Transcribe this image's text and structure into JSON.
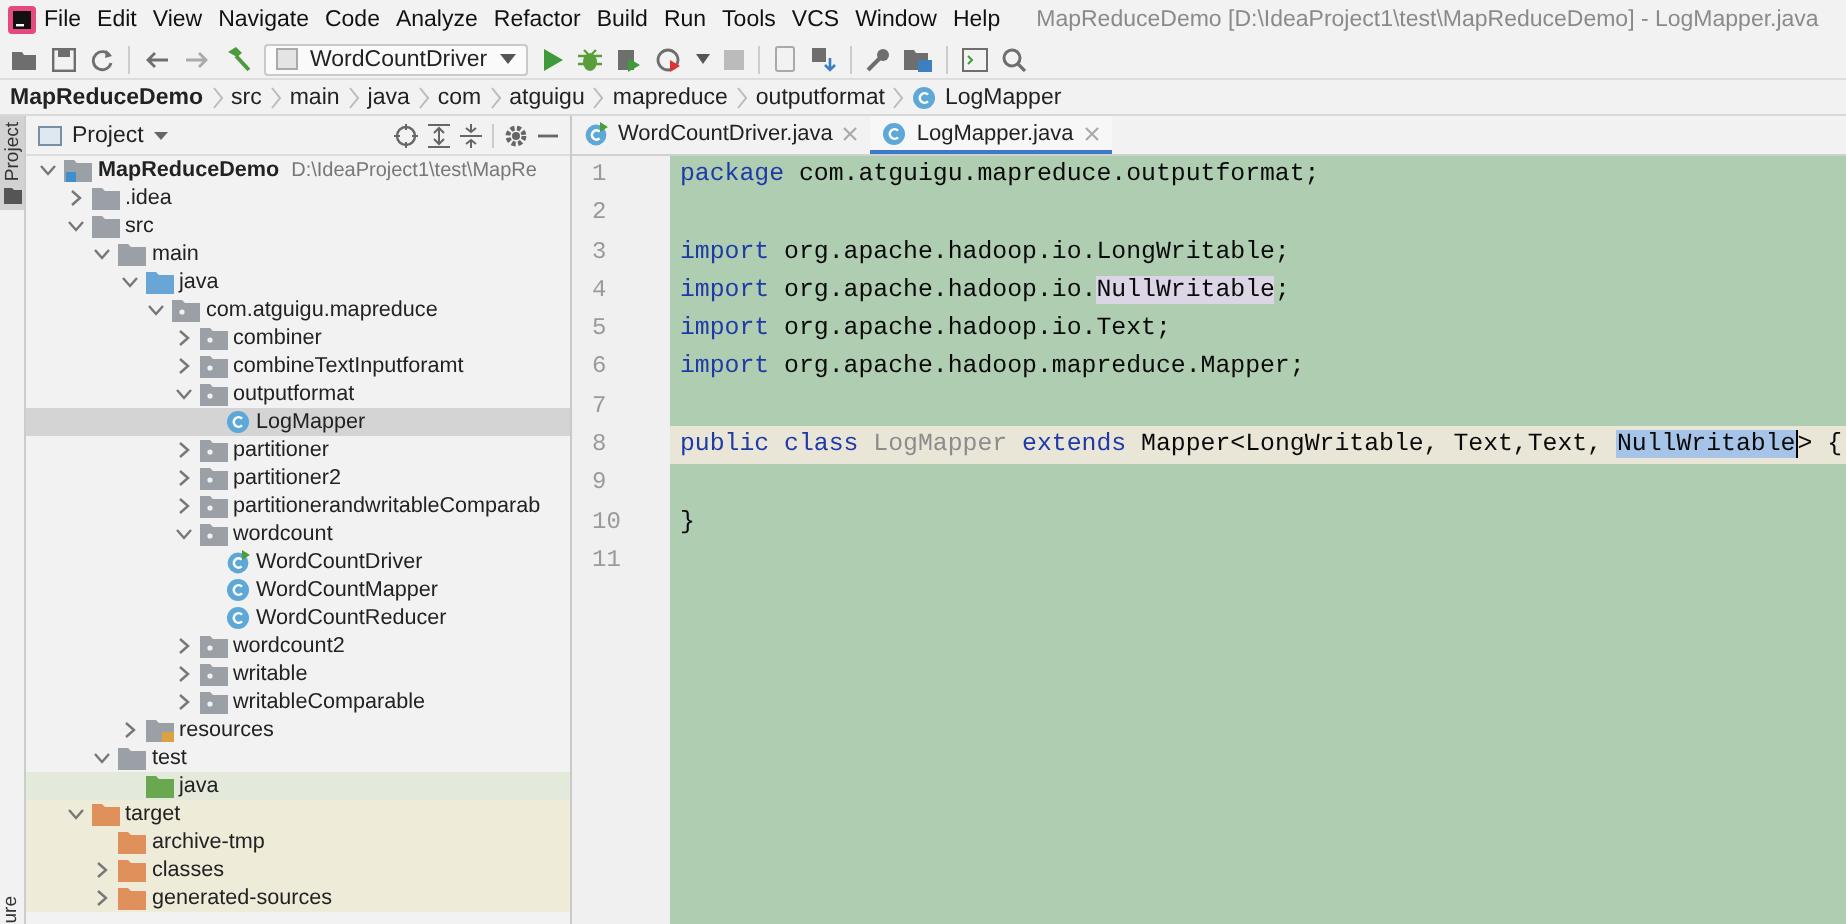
{
  "window": {
    "title": "MapReduceDemo [D:\\IdeaProject1\\test\\MapReduceDemo] - LogMapper.java"
  },
  "menu": [
    "File",
    "Edit",
    "View",
    "Navigate",
    "Code",
    "Analyze",
    "Refactor",
    "Build",
    "Run",
    "Tools",
    "VCS",
    "Window",
    "Help"
  ],
  "toolbar": {
    "run_config": "WordCountDriver"
  },
  "breadcrumbs": [
    {
      "label": "MapReduceDemo",
      "kind": "project"
    },
    {
      "label": "src",
      "kind": "dir"
    },
    {
      "label": "main",
      "kind": "dir"
    },
    {
      "label": "java",
      "kind": "dir"
    },
    {
      "label": "com",
      "kind": "dir"
    },
    {
      "label": "atguigu",
      "kind": "dir"
    },
    {
      "label": "mapreduce",
      "kind": "dir"
    },
    {
      "label": "outputformat",
      "kind": "dir"
    },
    {
      "label": "LogMapper",
      "kind": "class"
    }
  ],
  "side_strip": {
    "tabs": [
      {
        "label": "Project",
        "selected": true
      }
    ],
    "bottom_label": "ure"
  },
  "project_panel": {
    "title": "Project",
    "tree": [
      {
        "label": "MapReduceDemo",
        "path": "D:\\IdeaProject1\\test\\MapRe",
        "kind": "module",
        "expanded": true,
        "selected": false,
        "children": [
          {
            "label": ".idea",
            "kind": "folder",
            "expanded": false,
            "selected": false
          },
          {
            "label": "src",
            "kind": "folder",
            "expanded": true,
            "selected": false,
            "children": [
              {
                "label": "main",
                "kind": "folder",
                "expanded": true,
                "selected": false,
                "children": [
                  {
                    "label": "java",
                    "kind": "source-root",
                    "expanded": true,
                    "selected": false,
                    "children": [
                      {
                        "label": "com.atguigu.mapreduce",
                        "kind": "package",
                        "expanded": true,
                        "selected": false,
                        "children": [
                          {
                            "label": "combiner",
                            "kind": "package",
                            "expanded": false,
                            "selected": false
                          },
                          {
                            "label": "combineTextInputforamt",
                            "kind": "package",
                            "expanded": false,
                            "selected": false
                          },
                          {
                            "label": "outputformat",
                            "kind": "package",
                            "expanded": true,
                            "selected": false,
                            "children": [
                              {
                                "label": "LogMapper",
                                "kind": "class",
                                "selected": true
                              }
                            ]
                          },
                          {
                            "label": "partitioner",
                            "kind": "package",
                            "expanded": false,
                            "selected": false
                          },
                          {
                            "label": "partitioner2",
                            "kind": "package",
                            "expanded": false,
                            "selected": false
                          },
                          {
                            "label": "partitionerandwritableComparab",
                            "kind": "package",
                            "expanded": false,
                            "selected": false
                          },
                          {
                            "label": "wordcount",
                            "kind": "package",
                            "expanded": true,
                            "selected": false,
                            "children": [
                              {
                                "label": "WordCountDriver",
                                "kind": "runnable-class",
                                "selected": false
                              },
                              {
                                "label": "WordCountMapper",
                                "kind": "class",
                                "selected": false
                              },
                              {
                                "label": "WordCountReducer",
                                "kind": "class",
                                "selected": false
                              }
                            ]
                          },
                          {
                            "label": "wordcount2",
                            "kind": "package",
                            "expanded": false,
                            "selected": false
                          },
                          {
                            "label": "writable",
                            "kind": "package",
                            "expanded": false,
                            "selected": false
                          },
                          {
                            "label": "writableComparable",
                            "kind": "package",
                            "expanded": false,
                            "selected": false
                          }
                        ]
                      }
                    ]
                  },
                  {
                    "label": "resources",
                    "kind": "resources-root",
                    "expanded": false,
                    "selected": false
                  }
                ]
              },
              {
                "label": "test",
                "kind": "folder",
                "expanded": true,
                "selected": false,
                "children": [
                  {
                    "label": "java",
                    "kind": "test-root",
                    "selected": false
                  }
                ]
              }
            ]
          },
          {
            "label": "target",
            "kind": "excluded",
            "expanded": true,
            "selected": false,
            "children": [
              {
                "label": "archive-tmp",
                "kind": "excluded",
                "selected": false
              },
              {
                "label": "classes",
                "kind": "excluded",
                "expanded": false,
                "selected": false
              },
              {
                "label": "generated-sources",
                "kind": "excluded",
                "expanded": false,
                "selected": false
              }
            ]
          }
        ]
      }
    ]
  },
  "editor": {
    "tabs": [
      {
        "label": "WordCountDriver.java",
        "kind": "runnable-class",
        "selected": false
      },
      {
        "label": "LogMapper.java",
        "kind": "class",
        "selected": true
      }
    ],
    "lines": [
      {
        "number": "1",
        "current": false,
        "tokens": [
          {
            "text": "package",
            "kind": "keyword"
          },
          {
            "text": " com.atguigu.mapreduce.outputformat;",
            "kind": "plain"
          }
        ]
      },
      {
        "number": "2",
        "current": false
      },
      {
        "number": "3",
        "current": false,
        "tokens": [
          {
            "text": "import",
            "kind": "keyword"
          },
          {
            "text": " org.apache.hadoop.io.LongWritable;",
            "kind": "plain"
          }
        ]
      },
      {
        "number": "4",
        "current": false,
        "tokens": [
          {
            "text": "import",
            "kind": "keyword"
          },
          {
            "text": " org.apache.hadoop.io.",
            "kind": "plain"
          },
          {
            "text": "NullWritable",
            "kind": "usage"
          },
          {
            "text": ";",
            "kind": "plain"
          }
        ]
      },
      {
        "number": "5",
        "current": false,
        "tokens": [
          {
            "text": "import",
            "kind": "keyword"
          },
          {
            "text": " org.apache.hadoop.io.Text;",
            "kind": "plain"
          }
        ]
      },
      {
        "number": "6",
        "current": false,
        "tokens": [
          {
            "text": "import",
            "kind": "keyword"
          },
          {
            "text": " org.apache.hadoop.mapreduce.Mapper;",
            "kind": "plain"
          }
        ]
      },
      {
        "number": "7",
        "current": false
      },
      {
        "number": "8",
        "current": true,
        "tokens": [
          {
            "text": "public",
            "kind": "keyword"
          },
          {
            "text": " class",
            "kind": "keyword"
          },
          {
            "text": " LogMapper",
            "kind": "unused"
          },
          {
            "text": " extends",
            "kind": "keyword"
          },
          {
            "text": " Mapper<LongWritable, Text,Text, ",
            "kind": "plain"
          },
          {
            "text": "NullWritable",
            "kind": "selection"
          },
          {
            "text": "> {",
            "kind": "plain"
          }
        ]
      },
      {
        "number": "9",
        "current": false
      },
      {
        "number": "10",
        "current": false,
        "tokens": [
          {
            "text": "}",
            "kind": "plain"
          }
        ]
      },
      {
        "number": "11",
        "current": false
      }
    ]
  }
}
